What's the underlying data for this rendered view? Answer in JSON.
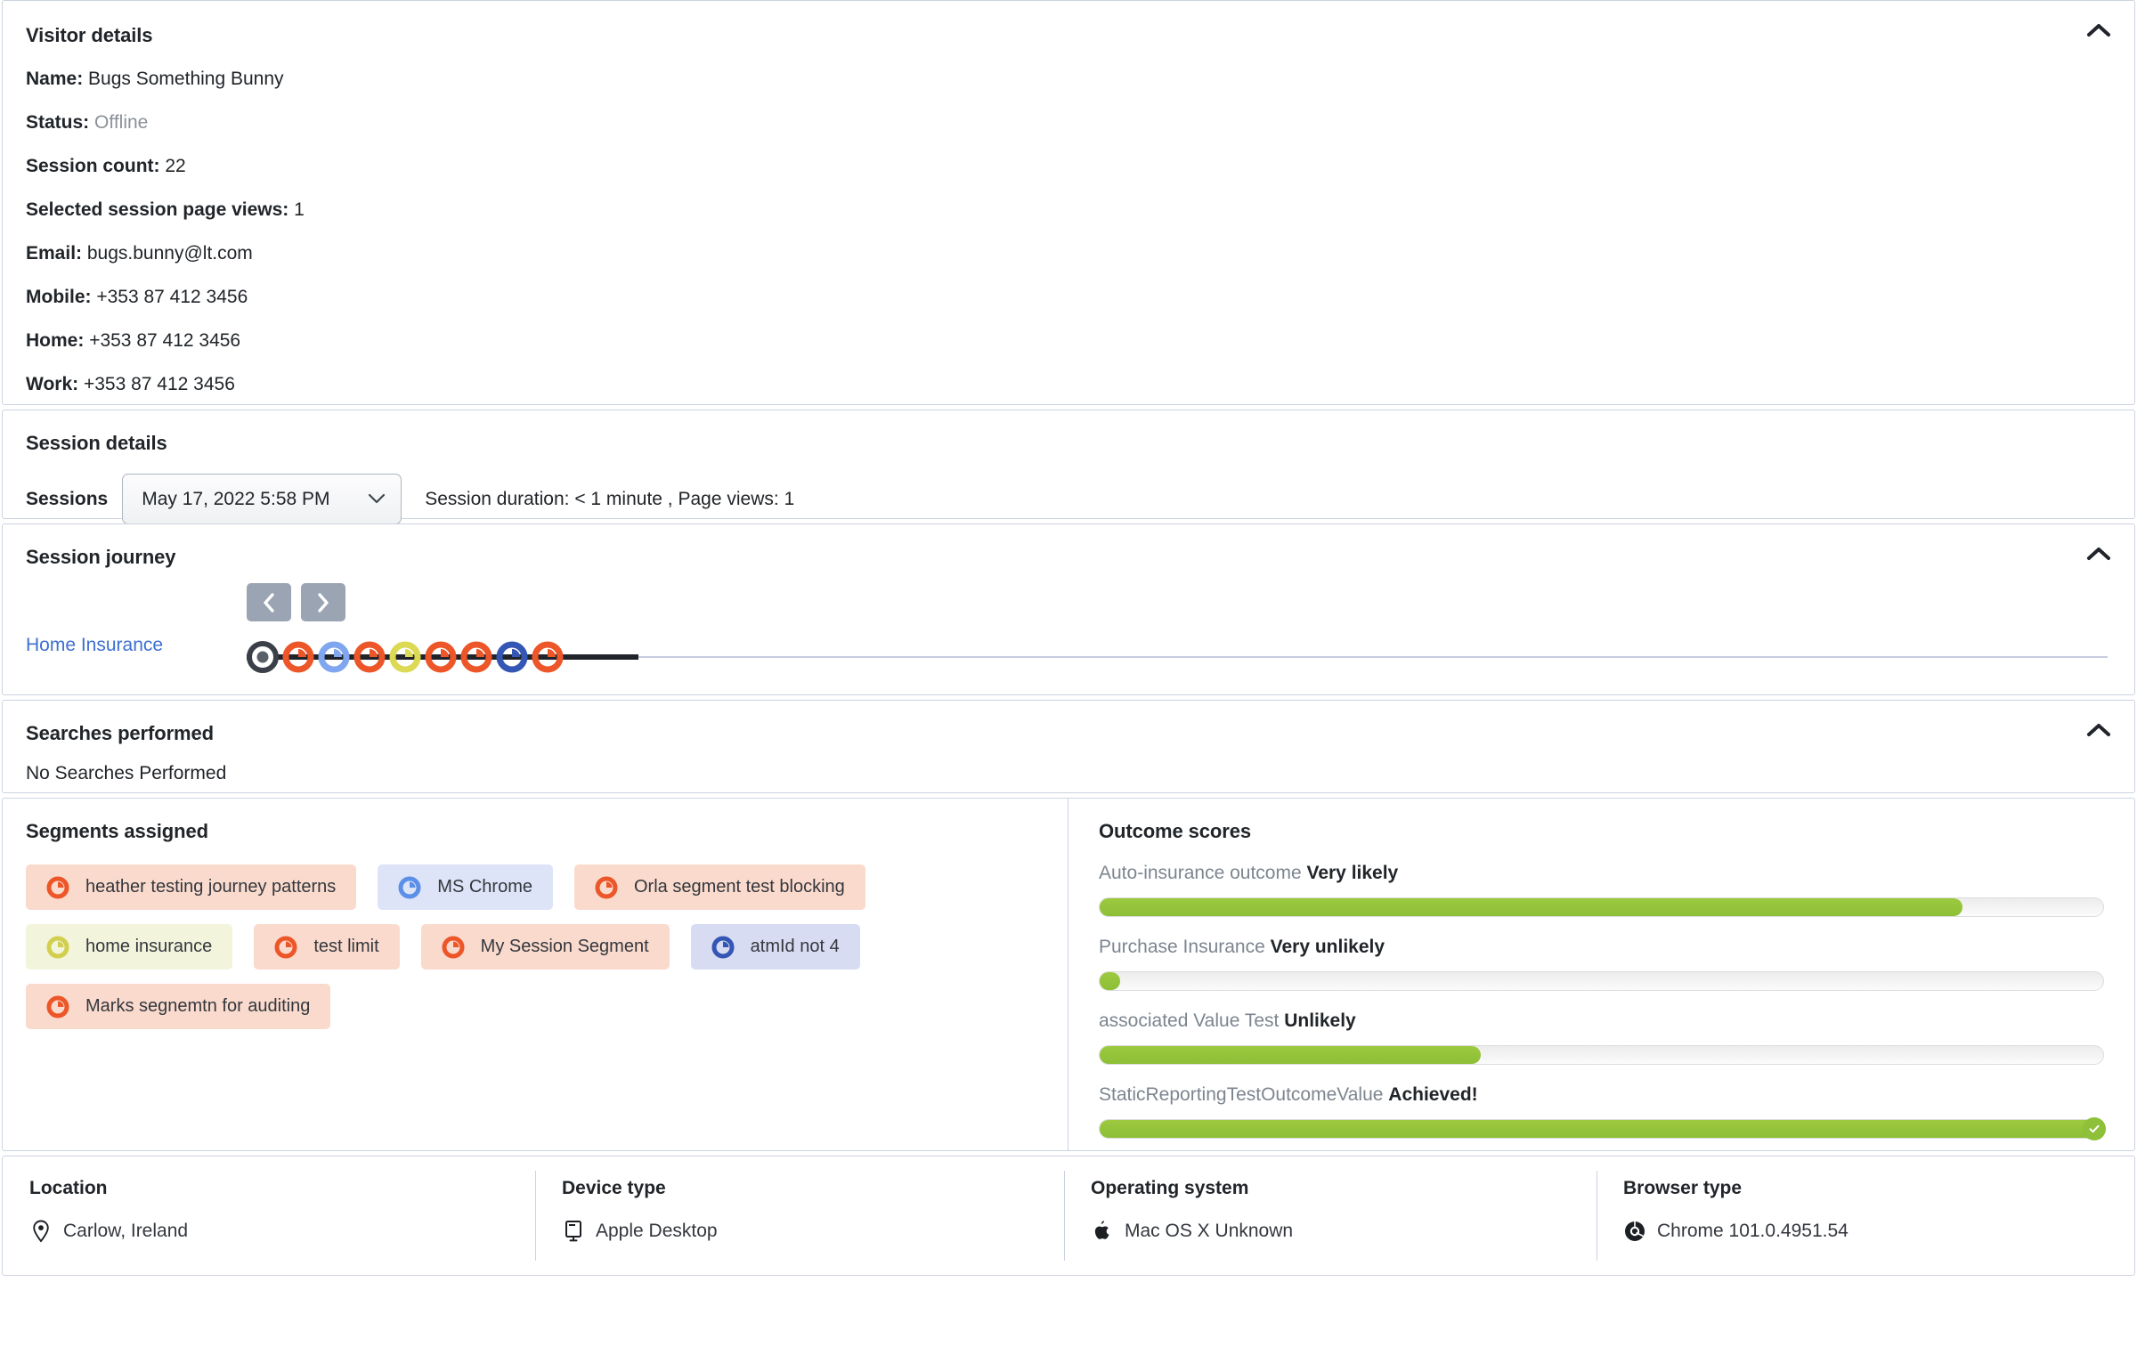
{
  "visitor": {
    "title": "Visitor details",
    "collapse_icon": "chevron-up-icon",
    "fields": [
      {
        "label": "Name:",
        "value": "Bugs Something Bunny",
        "muted": false
      },
      {
        "label": "Status:",
        "value": "Offline",
        "muted": true
      },
      {
        "label": "Session count:",
        "value": "22",
        "muted": false
      },
      {
        "label": "Selected session page views:",
        "value": "1",
        "muted": false
      },
      {
        "label": "Email:",
        "value": "bugs.bunny@lt.com",
        "muted": false
      },
      {
        "label": "Mobile:",
        "value": "+353 87 412 3456",
        "muted": false
      },
      {
        "label": "Home:",
        "value": "+353 87 412 3456",
        "muted": false
      },
      {
        "label": "Work:",
        "value": "+353 87 412 3456",
        "muted": false
      }
    ]
  },
  "session": {
    "title": "Session details",
    "sessions_label": "Sessions",
    "selected_session": "May 17, 2022 5:58 PM",
    "meta": "Session duration: < 1 minute , Page views: 1"
  },
  "journey": {
    "title": "Session journey",
    "collapse_icon": "chevron-up-icon",
    "prev_icon": "chevron-left-icon",
    "next_icon": "chevron-right-icon",
    "page_label": "Home Insurance",
    "nodes": [
      {
        "type": "start",
        "color": "#3b4048"
      },
      {
        "type": "pie",
        "color": "#ec5628"
      },
      {
        "type": "pie",
        "color": "#7fa6ee"
      },
      {
        "type": "pie",
        "color": "#ec5628"
      },
      {
        "type": "pie",
        "color": "#dcd954"
      },
      {
        "type": "pie",
        "color": "#ec5628"
      },
      {
        "type": "pie",
        "color": "#ec5628"
      },
      {
        "type": "pie",
        "color": "#3456b4"
      },
      {
        "type": "pie",
        "color": "#ec5628"
      }
    ]
  },
  "searches": {
    "title": "Searches performed",
    "collapse_icon": "chevron-up-icon",
    "empty_text": "No Searches Performed"
  },
  "segments": {
    "title": "Segments assigned",
    "items": [
      {
        "label": "heather testing journey patterns",
        "tone": "red",
        "icon_color": "#ec5628"
      },
      {
        "label": "MS Chrome",
        "tone": "blue",
        "icon_color": "#5b8fe8"
      },
      {
        "label": "Orla segment test blocking",
        "tone": "red",
        "icon_color": "#ec5628"
      },
      {
        "label": "home insurance",
        "tone": "olive",
        "icon_color": "#d2cf4e"
      },
      {
        "label": "test limit",
        "tone": "red",
        "icon_color": "#ec5628"
      },
      {
        "label": "My Session Segment",
        "tone": "red",
        "icon_color": "#ec5628"
      },
      {
        "label": "atmId not 4",
        "tone": "navy",
        "icon_color": "#3456b4"
      },
      {
        "label": "Marks segnemtn for auditing",
        "tone": "red",
        "icon_color": "#ec5628"
      }
    ]
  },
  "outcomes": {
    "title": "Outcome scores",
    "bar_color": "#93c23c",
    "items": [
      {
        "name": "Auto-insurance outcome",
        "status": "Very likely",
        "percent": 86,
        "achieved": false
      },
      {
        "name": "Purchase Insurance",
        "status": "Very unlikely",
        "percent": 2,
        "achieved": false
      },
      {
        "name": "associated Value Test",
        "status": "Unlikely",
        "percent": 38,
        "achieved": false
      },
      {
        "name": "StaticReportingTestOutcomeValue",
        "status": "Achieved!",
        "percent": 100,
        "achieved": true
      }
    ]
  },
  "meta": {
    "cells": [
      {
        "title": "Location",
        "value": "Carlow, Ireland",
        "icon": "map-pin-icon"
      },
      {
        "title": "Device type",
        "value": "Apple Desktop",
        "icon": "desktop-icon"
      },
      {
        "title": "Operating system",
        "value": "Mac OS X Unknown",
        "icon": "apple-icon"
      },
      {
        "title": "Browser type",
        "value": "Chrome 101.0.4951.54",
        "icon": "chrome-icon"
      }
    ]
  }
}
